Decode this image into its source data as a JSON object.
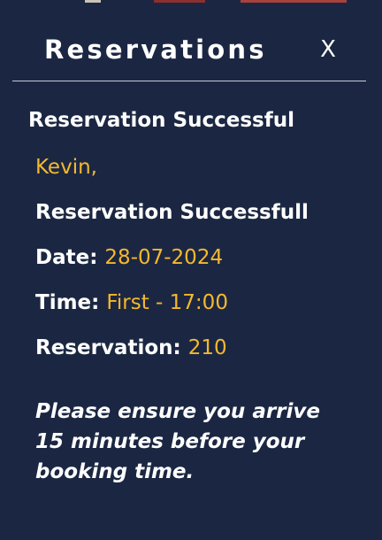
{
  "modal": {
    "title": "Reservations",
    "close_label": "X"
  },
  "confirmation": {
    "heading": "Reservation Successful",
    "greeting": "Kevin,",
    "status": "Reservation Successfull",
    "date_label": "Date:",
    "date_value": "28-07-2024",
    "time_label": "Time:",
    "time_value": "First - 17:00",
    "reservation_label": "Reservation:",
    "reservation_value": "210",
    "notice": "Please ensure you arrive 15 minutes before your booking time."
  },
  "colors": {
    "background": "#1b2742",
    "accent": "#f5b82e",
    "text": "#ffffff"
  }
}
